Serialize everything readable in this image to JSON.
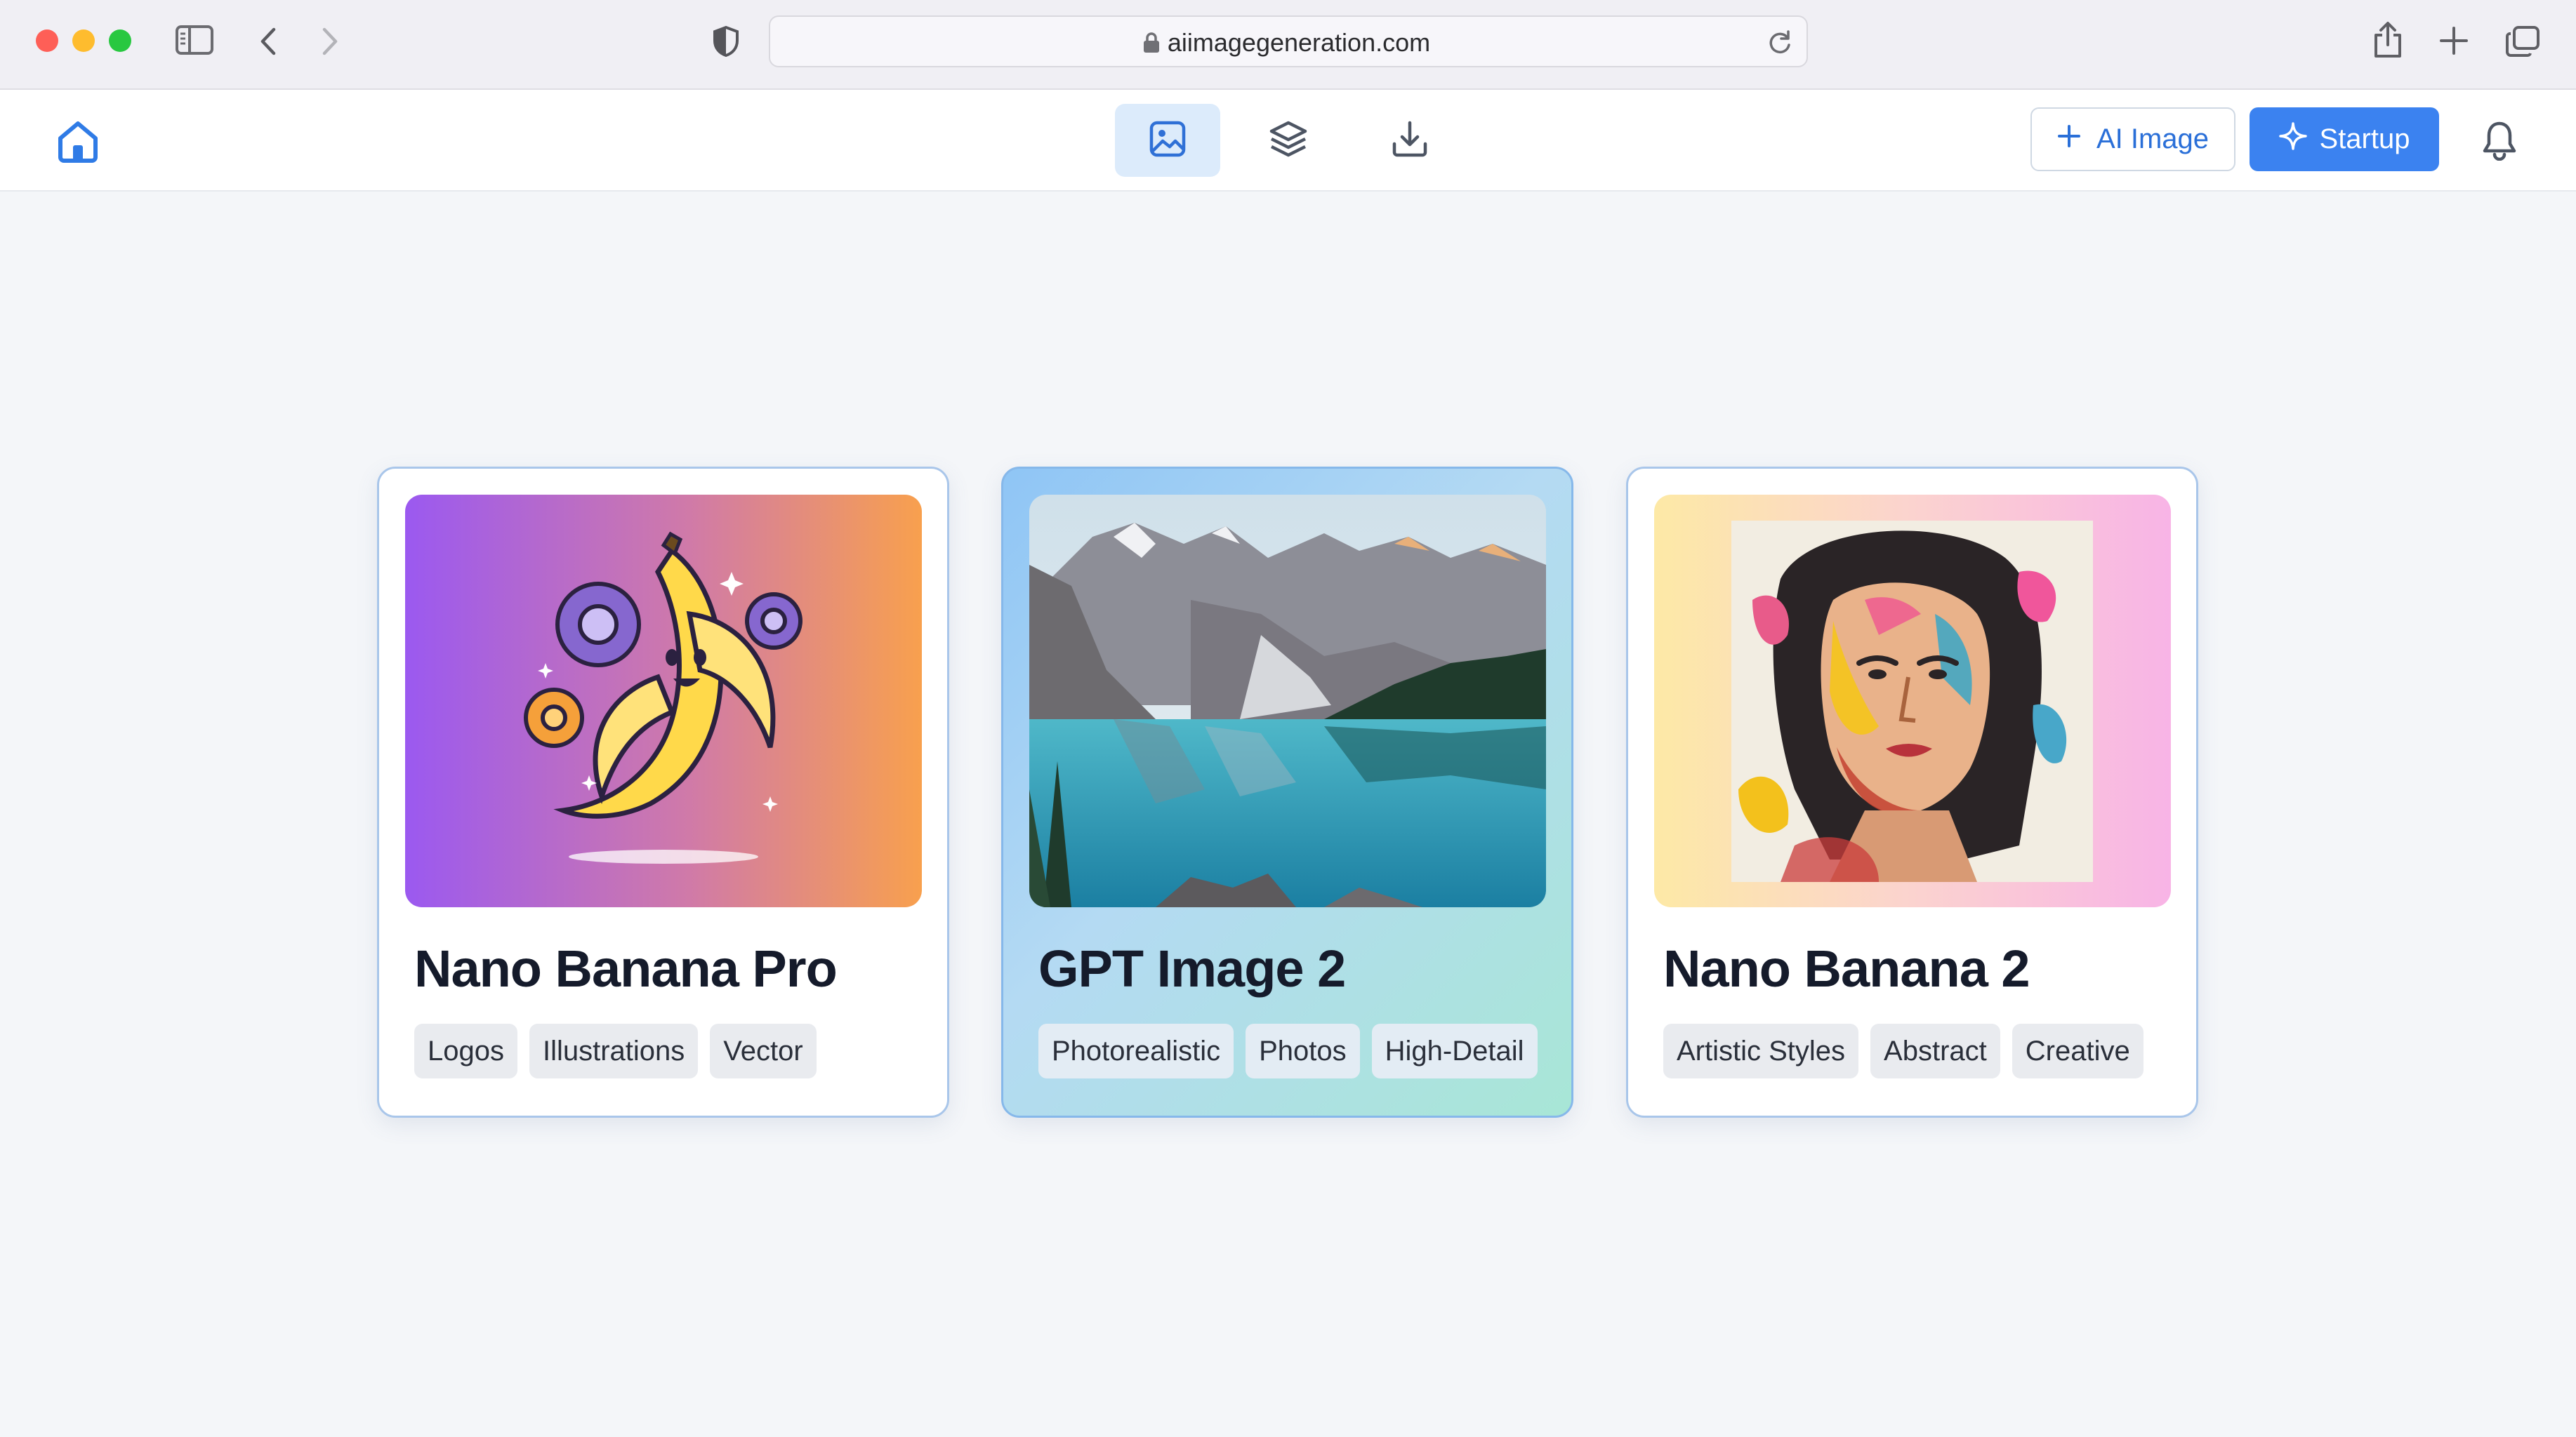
{
  "browser": {
    "url": "aiimagegeneration.com"
  },
  "header": {
    "nav_tabs": [
      {
        "icon": "image-icon",
        "active": true
      },
      {
        "icon": "layers-icon",
        "active": false
      },
      {
        "icon": "download-icon",
        "active": false
      }
    ],
    "ai_image_button": "AI Image",
    "startup_button": "Startup"
  },
  "cards": [
    {
      "title": "Nano Banana Pro",
      "image": "cartoon-banana-with-gears",
      "tags": [
        "Logos",
        "Illustrations",
        "Vector"
      ]
    },
    {
      "title": "GPT Image 2",
      "image": "mountain-lake-landscape",
      "tags": [
        "Photorealistic",
        "Photos",
        "High-Detail"
      ]
    },
    {
      "title": "Nano Banana 2",
      "image": "abstract-painted-portrait",
      "tags": [
        "Artistic Styles",
        "Abstract",
        "Creative"
      ]
    }
  ],
  "colors": {
    "accent": "#3b82f0",
    "accent_text": "#2a6fd8",
    "active_tab_bg": "#dcebfb"
  }
}
